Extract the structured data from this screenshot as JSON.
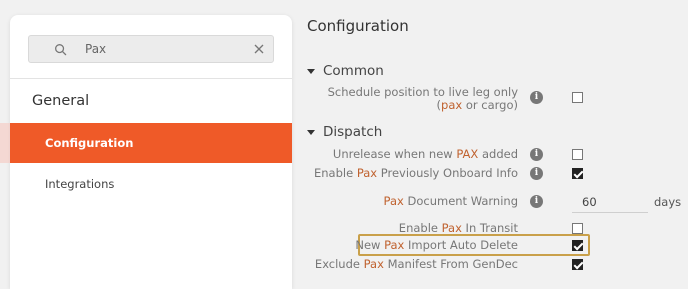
{
  "sidebar": {
    "search": {
      "value": "Pax"
    },
    "group_heading": "General",
    "items": [
      {
        "label": "Configuration",
        "active": true
      },
      {
        "label": "Integrations",
        "active": false
      }
    ]
  },
  "main": {
    "title": "Configuration",
    "sections": [
      {
        "heading": "Common",
        "rows": [
          {
            "label_line1": "Schedule position to live leg only",
            "label_line2_pre": "(",
            "label_line2_hl": "pax",
            "label_line2_post": " or cargo)",
            "info": true,
            "checked": false
          }
        ]
      },
      {
        "heading": "Dispatch",
        "rows": [
          {
            "pre": "Unrelease when new ",
            "hl": "PAX",
            "post": " added",
            "info": true,
            "checked": false
          },
          {
            "pre": "Enable ",
            "hl": "Pax",
            "post": " Previously Onboard Info",
            "info": true,
            "checked": true
          },
          {
            "pre": "",
            "hl": "Pax",
            "post": " Document Warning",
            "info": true,
            "value": "60",
            "unit": "days"
          },
          {
            "pre": "Enable ",
            "hl": "Pax",
            "post": " In Transit",
            "info": false,
            "checked": false
          },
          {
            "pre": "New ",
            "hl": "Pax",
            "post": " Import Auto Delete",
            "info": false,
            "checked": true,
            "highlighted": true
          },
          {
            "pre": "Exclude ",
            "hl": "Pax",
            "post": " Manifest From GenDec",
            "info": false,
            "checked": true
          }
        ]
      }
    ]
  },
  "colors": {
    "accent": "#ef5a28",
    "highlight_text": "#c0622f",
    "highlight_border": "#c9a04a"
  }
}
